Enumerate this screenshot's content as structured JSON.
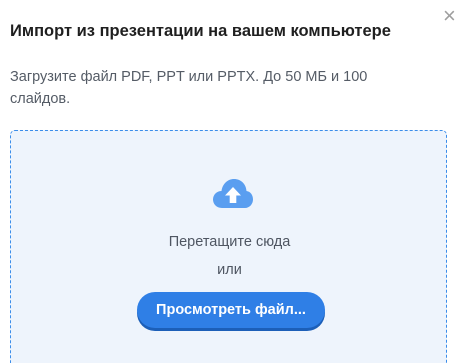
{
  "dialog": {
    "title": "Импорт из презентации на вашем компьютере",
    "close_icon": "close-icon",
    "close_glyph": "×",
    "description": "Загрузите файл PDF, PPT или PPTX. До 50 МБ и 100 слайдов."
  },
  "dropzone": {
    "icon": "cloud-upload-icon",
    "drag_text": "Перетащите сюда",
    "or_text": "или",
    "browse_label": "Просмотреть файл..."
  },
  "colors": {
    "accent": "#2f7fe6",
    "dropzone_border": "#3b8dea",
    "dropzone_bg": "#eef4fc",
    "cloud_icon": "#5a9ef0"
  }
}
